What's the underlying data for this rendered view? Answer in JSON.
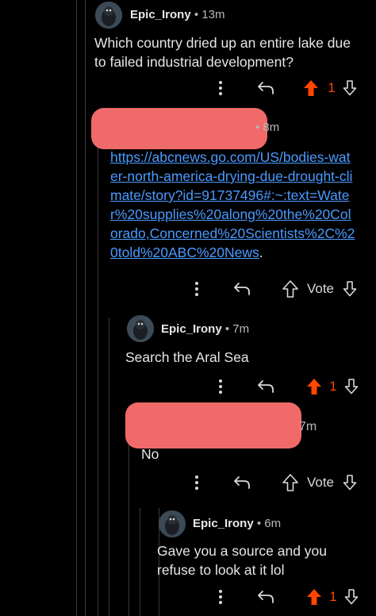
{
  "colors": {
    "background": "#000000",
    "text": "#e6e6e6",
    "muted": "#b8b8b8",
    "link": "#4a9bff",
    "upvote": "#ff4500",
    "redaction": "#f06a6a",
    "thread_line": "#3a3a3c"
  },
  "comments": [
    {
      "username": "Epic_Irony",
      "time": "13m",
      "body": "Which country dried up an entire lake due to failed industrial development?",
      "score": "1",
      "upvoted": true
    },
    {
      "username": "",
      "time": "8m",
      "link": "https://abcnews.go.com/US/bodies-water-north-america-drying-due-drought-climate/story?id=91737496#:~:text=Water%20supplies%20along%20the%20Colorado,Concerned%20Scientists%2C%20told%20ABC%20News",
      "link_suffix": ".",
      "vote_label": "Vote"
    },
    {
      "username": "Epic_Irony",
      "time": "7m",
      "body": "Search the Aral Sea",
      "score": "1",
      "upvoted": true
    },
    {
      "username": "",
      "time": "7m",
      "body": "No",
      "vote_label": "Vote"
    },
    {
      "username": "Epic_Irony",
      "time": "6m",
      "body": "Gave you a source and you refuse to look at it lol",
      "score": "1",
      "upvoted": true
    }
  ],
  "icons": {
    "more": "more-vertical-icon",
    "reply": "reply-icon",
    "upvote": "upvote-arrow-icon",
    "downvote": "downvote-arrow-icon"
  }
}
